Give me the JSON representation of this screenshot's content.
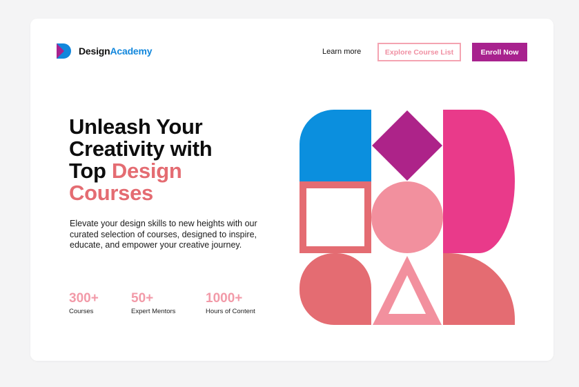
{
  "brand": {
    "name_part1": "Design",
    "name_part2": "Academy",
    "colors": {
      "blue": "#1287dc",
      "magenta": "#a8228e",
      "pink": "#f08fa2",
      "coral": "#e46c72"
    }
  },
  "nav": {
    "learn_more": "Learn more",
    "explore": "Explore Course List",
    "enroll": "Enroll Now"
  },
  "hero": {
    "title_line1": "Unleash Your",
    "title_line2": "Creativity with",
    "title_line3_prefix": "Top ",
    "title_accent1": "Design",
    "title_accent2": "Courses",
    "description": "Elevate your design skills to new heights with our curated selection of courses, designed to inspire, educate, and empower your creative journey."
  },
  "stats": [
    {
      "value": "300+",
      "label": "Courses"
    },
    {
      "value": "50+",
      "label": "Expert Mentors"
    },
    {
      "value": "1000+",
      "label": "Hours of Content"
    }
  ],
  "art": {
    "icons": [
      "rounded-blue-tile",
      "magenta-diamond",
      "pink-d-shape",
      "coral-square-outline",
      "pink-circle",
      "coral-quarter-tile",
      "pink-triangle-outline",
      "coral-quarter-shape"
    ]
  }
}
